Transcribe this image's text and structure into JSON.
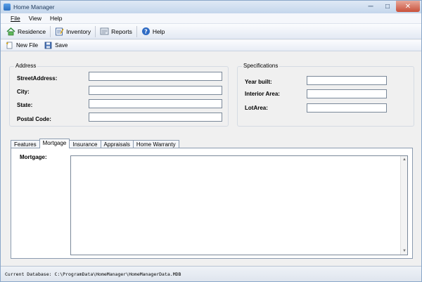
{
  "window": {
    "title": "Home Manager",
    "minimize": "─",
    "maximize": "□",
    "close": "✕"
  },
  "menu": {
    "items": [
      "File",
      "View",
      "Help"
    ]
  },
  "toolbar": {
    "residence": "Residence",
    "inventory": "Inventory",
    "reports": "Reports",
    "help": "Help"
  },
  "toolbar2": {
    "new_file": "New File",
    "save": "Save"
  },
  "address": {
    "title": "Address",
    "street_label": "StreetAddress:",
    "city_label": "City:",
    "state_label": "State:",
    "postal_label": "Postal Code:",
    "street_value": "",
    "city_value": "",
    "state_value": "",
    "postal_value": ""
  },
  "specifications": {
    "title": "Specifications",
    "year_label": "Year built:",
    "interior_label": "Interior Area:",
    "lot_label": "LotArea:",
    "year_value": "",
    "interior_value": "",
    "lot_value": ""
  },
  "tabs": [
    {
      "label": "Features",
      "active": false
    },
    {
      "label": "Mortgage",
      "active": true
    },
    {
      "label": "Insurance",
      "active": false
    },
    {
      "label": "Appraisals",
      "active": false
    },
    {
      "label": "Home Warranty",
      "active": false
    }
  ],
  "mortgage": {
    "label": "Mortgage:",
    "value": ""
  },
  "status": {
    "text": "Current Database: C:\\ProgramData\\HomeManager\\HomeManagerData.MDB"
  }
}
